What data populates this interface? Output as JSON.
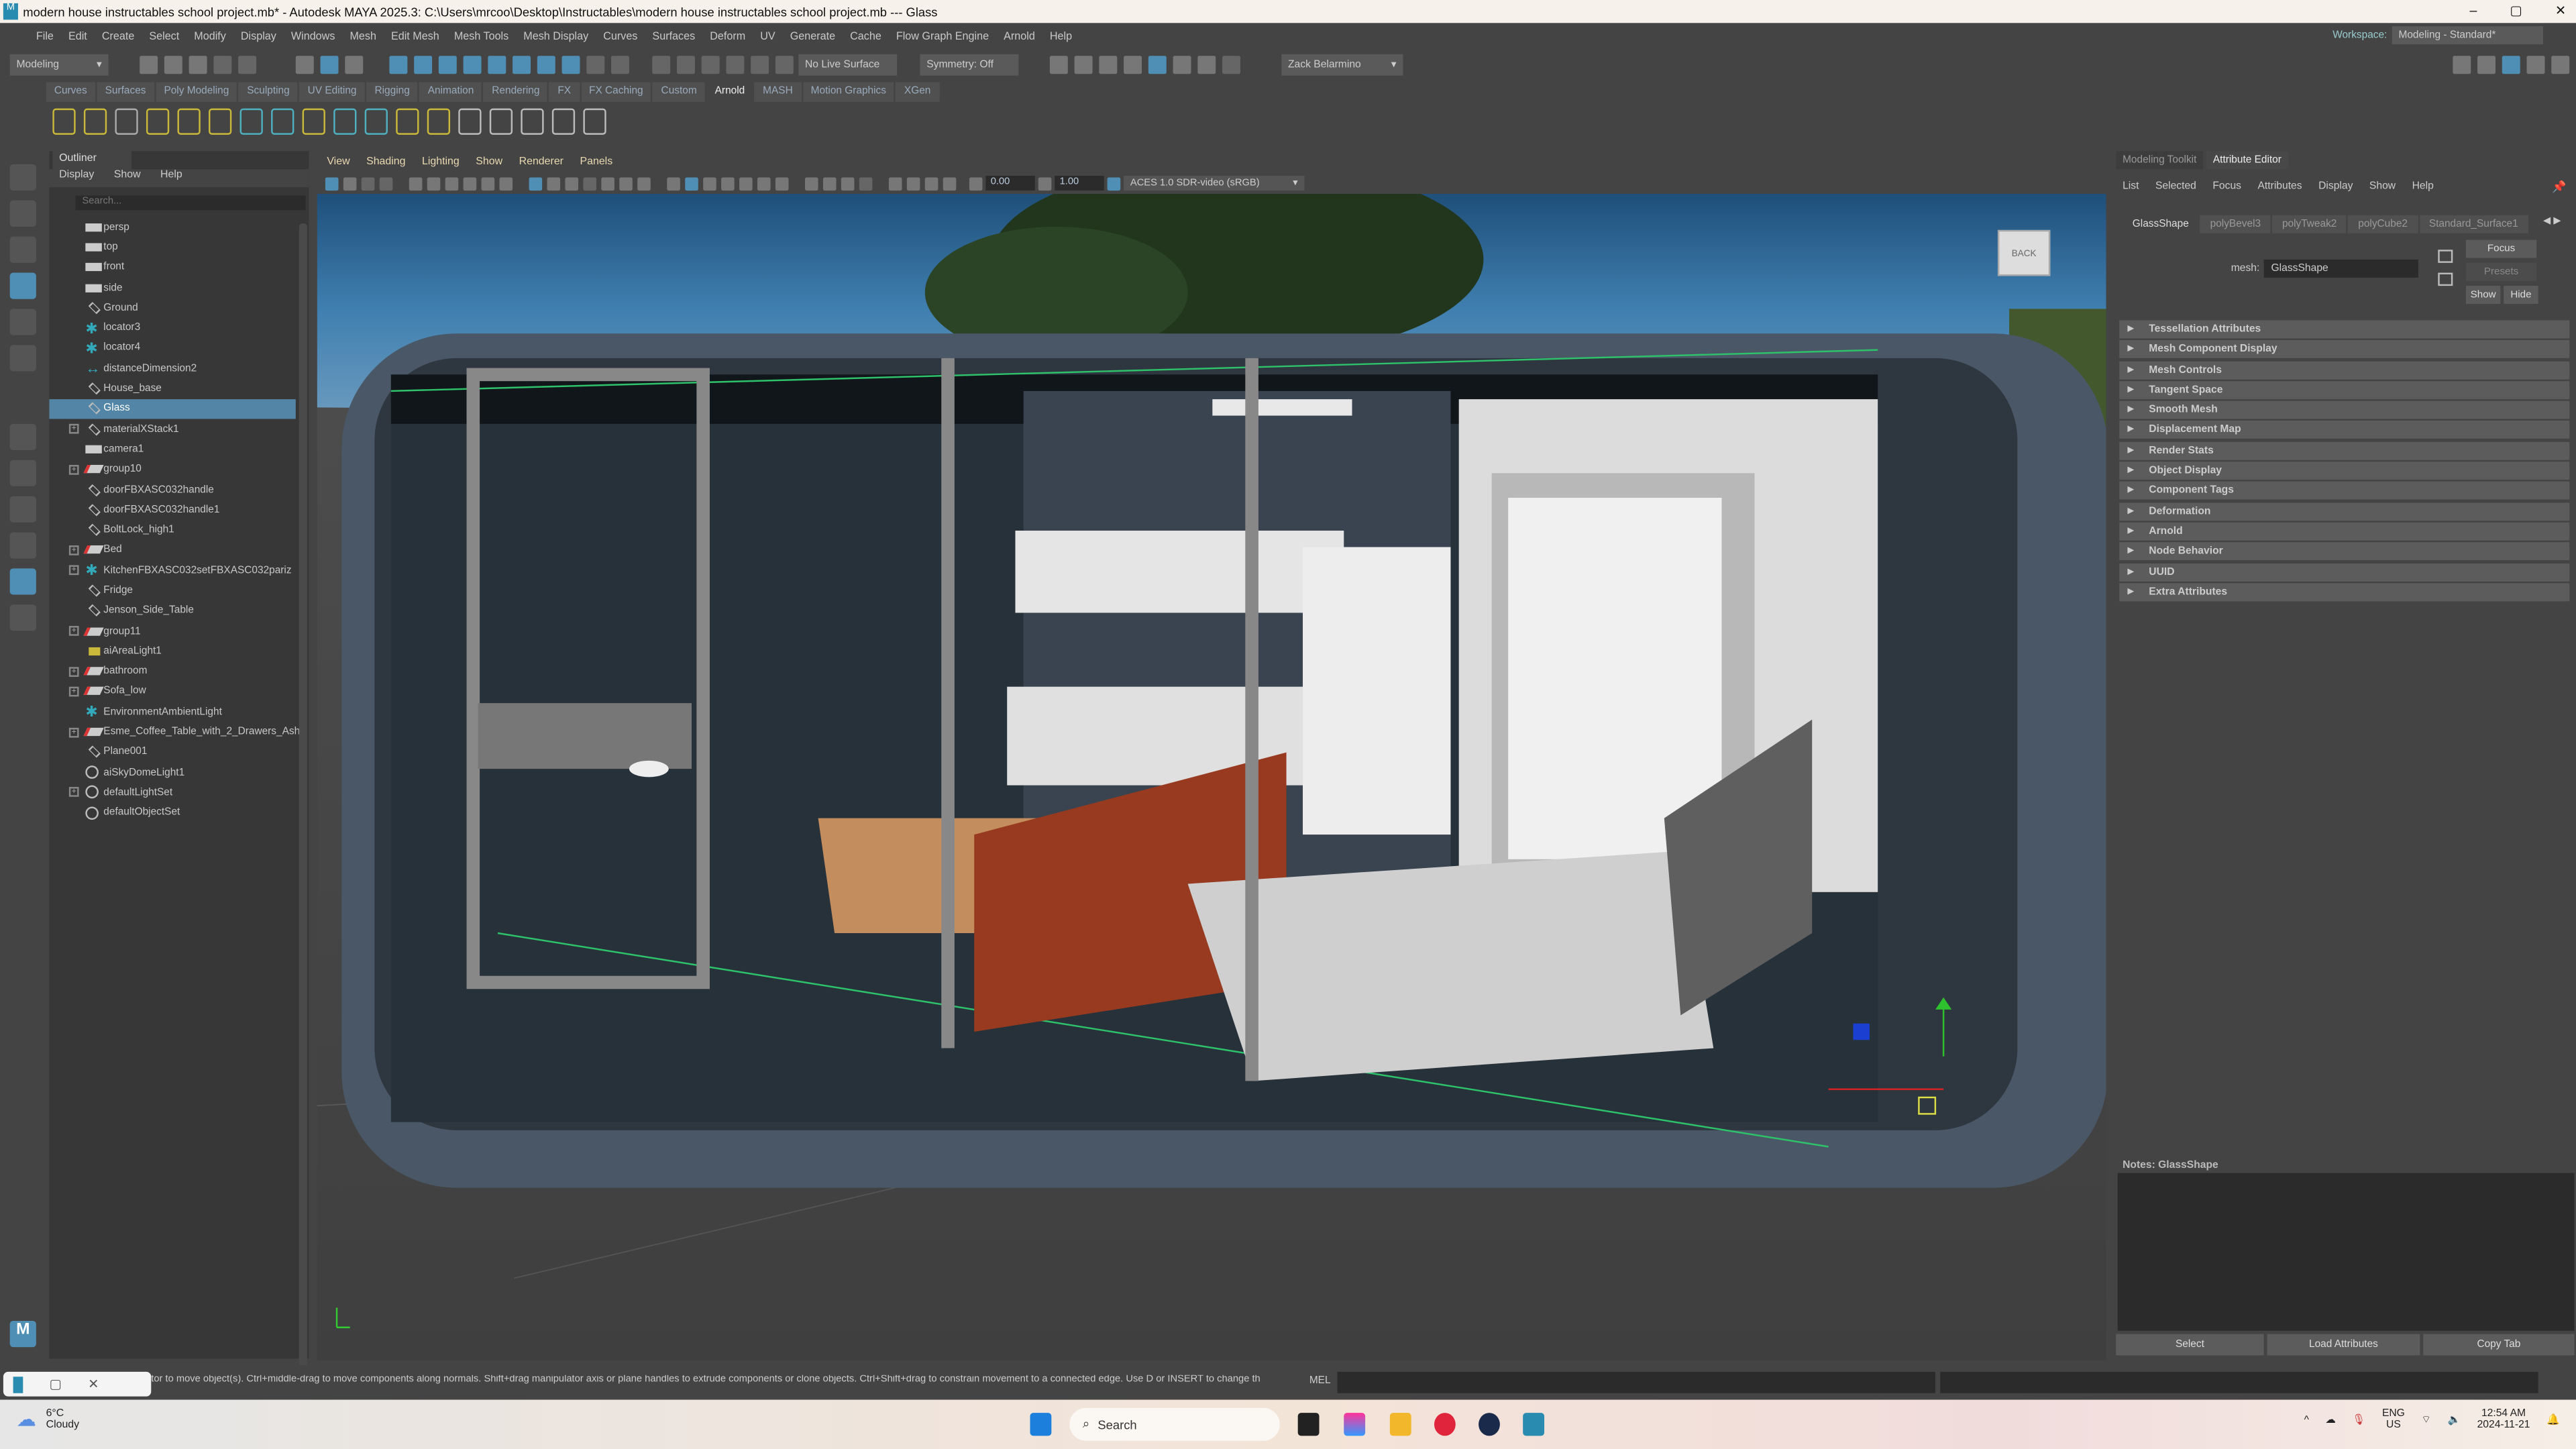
{
  "window": {
    "title": "modern house instructables school project.mb* - Autodesk MAYA 2025.3: C:\\Users\\mrcoo\\Desktop\\Instructables\\modern house instructables school project.mb  ---  Glass",
    "minimize": "–",
    "maximize": "▢",
    "close": "✕"
  },
  "menubar": {
    "items": [
      "File",
      "Edit",
      "Create",
      "Select",
      "Modify",
      "Display",
      "Windows",
      "Mesh",
      "Edit Mesh",
      "Mesh Tools",
      "Mesh Display",
      "Curves",
      "Surfaces",
      "Deform",
      "UV",
      "Generate",
      "Cache",
      "Flow Graph Engine",
      "Arnold",
      "Help"
    ],
    "workspace_label": "Workspace:",
    "workspace_value": "Modeling - Standard*"
  },
  "toolbar": {
    "mode": "Modeling",
    "live_surface": "No Live Surface",
    "symmetry": "Symmetry: Off",
    "user": "Zack Belarmino"
  },
  "shelf": {
    "tabs": [
      "Curves",
      "Surfaces",
      "Poly Modeling",
      "Sculpting",
      "UV Editing",
      "Rigging",
      "Animation",
      "Rendering",
      "FX",
      "FX Caching",
      "Custom",
      "Arnold",
      "MASH",
      "Motion Graphics",
      "XGen"
    ],
    "active": "Arnold"
  },
  "outliner": {
    "title": "Outliner",
    "menu": [
      "Display",
      "Show",
      "Help"
    ],
    "search_placeholder": "Search...",
    "items": [
      {
        "label": "persp",
        "icon": "camera",
        "expandable": false
      },
      {
        "label": "top",
        "icon": "camera",
        "expandable": false
      },
      {
        "label": "front",
        "icon": "camera",
        "expandable": false
      },
      {
        "label": "side",
        "icon": "camera",
        "expandable": false
      },
      {
        "label": "Ground",
        "icon": "mesh",
        "expandable": false
      },
      {
        "label": "locator3",
        "icon": "locator",
        "expandable": false
      },
      {
        "label": "locator4",
        "icon": "locator",
        "expandable": false
      },
      {
        "label": "distanceDimension2",
        "icon": "dimension",
        "expandable": false
      },
      {
        "label": "House_base",
        "icon": "mesh",
        "expandable": false
      },
      {
        "label": "Glass",
        "icon": "mesh",
        "expandable": false,
        "selected": true
      },
      {
        "label": "materialXStack1",
        "icon": "stack",
        "expandable": true
      },
      {
        "label": "camera1",
        "icon": "camera",
        "expandable": false
      },
      {
        "label": "group10",
        "icon": "group",
        "expandable": true
      },
      {
        "label": "doorFBXASC032handle",
        "icon": "mesh",
        "expandable": false
      },
      {
        "label": "doorFBXASC032handle1",
        "icon": "mesh",
        "expandable": false
      },
      {
        "label": "BoltLock_high1",
        "icon": "mesh",
        "expandable": false
      },
      {
        "label": "Bed",
        "icon": "group",
        "expandable": true
      },
      {
        "label": "KitchenFBXASC032setFBXASC032pariz",
        "icon": "locator",
        "expandable": true
      },
      {
        "label": "Fridge",
        "icon": "mesh",
        "expandable": false
      },
      {
        "label": "Jenson_Side_Table",
        "icon": "mesh",
        "expandable": false
      },
      {
        "label": "group11",
        "icon": "group",
        "expandable": true
      },
      {
        "label": "aiAreaLight1",
        "icon": "light",
        "expandable": false
      },
      {
        "label": "bathroom",
        "icon": "group",
        "expandable": true
      },
      {
        "label": "Sofa_low",
        "icon": "group",
        "expandable": true
      },
      {
        "label": "EnvironmentAmbientLight",
        "icon": "locator",
        "expandable": false
      },
      {
        "label": "Esme_Coffee_Table_with_2_Drawers_Ash_",
        "icon": "group",
        "expandable": true
      },
      {
        "label": "Plane001",
        "icon": "mesh",
        "expandable": false
      },
      {
        "label": "aiSkyDomeLight1",
        "icon": "skydome",
        "expandable": false
      },
      {
        "label": "defaultLightSet",
        "icon": "set",
        "expandable": true
      },
      {
        "label": "defaultObjectSet",
        "icon": "set",
        "expandable": false
      }
    ]
  },
  "viewport": {
    "menu": [
      "View",
      "Shading",
      "Lighting",
      "Show",
      "Renderer",
      "Panels"
    ],
    "exposure": "0.00",
    "gamma": "1.00",
    "color_space": "ACES 1.0 SDR-video (sRGB)",
    "viewcube_label": "BACK"
  },
  "right_panel": {
    "tabs": [
      "Modeling Toolkit",
      "Attribute Editor"
    ],
    "active_tab": "Attribute Editor",
    "menu": [
      "List",
      "Selected",
      "Focus",
      "Attributes",
      "Display",
      "Show",
      "Help"
    ],
    "node_tabs": [
      "GlassShape",
      "polyBevel3",
      "polyTweak2",
      "polyCube2",
      "Standard_Surface1"
    ],
    "mesh_label": "mesh:",
    "mesh_value": "GlassShape",
    "focus": "Focus",
    "presets": "Presets",
    "show": "Show",
    "hide": "Hide",
    "sections": [
      "Tessellation Attributes",
      "Mesh Component Display",
      "Mesh Controls",
      "Tangent Space",
      "Smooth Mesh",
      "Displacement Map",
      "Render Stats",
      "Object Display",
      "Component Tags",
      "Deformation",
      "Arnold",
      "Node Behavior",
      "UUID",
      "Extra Attributes"
    ],
    "notes_label": "Notes:  GlassShape",
    "buttons": [
      "Select",
      "Load Attributes",
      "Copy Tab"
    ]
  },
  "status": {
    "help_line": "tor to move object(s). Ctrl+middle-drag to move components along normals. Shift+drag manipulator axis or plane handles to extrude components or clone objects. Ctrl+Shift+drag to constrain movement to a connected edge. Use D or INSERT to change th",
    "mel_label": "MEL"
  },
  "taskbar": {
    "temp": "6°C",
    "weather": "Cloudy",
    "search": "Search",
    "lang": "ENG",
    "region": "US",
    "time": "12:54 AM",
    "date": "2024-11-21"
  },
  "colors": {
    "accent": "#5285a6",
    "panel": "#444444",
    "selection": "#5285a6"
  }
}
